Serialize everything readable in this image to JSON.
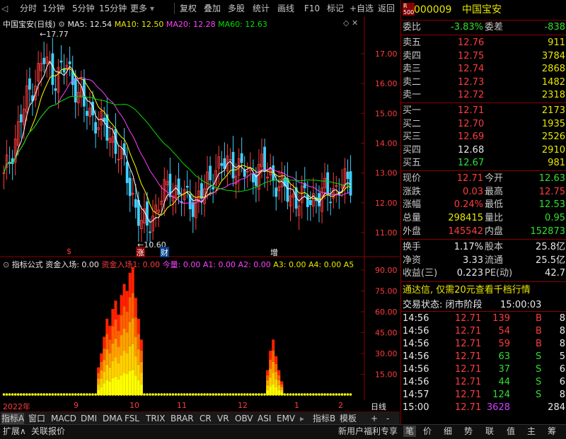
{
  "toolbar": {
    "left": [
      "分时",
      "1分钟",
      "5分钟",
      "15分钟",
      "更多"
    ],
    "right": [
      "复权",
      "叠加",
      "多股",
      "统计",
      "画线",
      "F10",
      "标记",
      "+自选",
      "返回"
    ]
  },
  "kline": {
    "title": "中国宝安(日线)",
    "ma5": "MA5: 12.54",
    "ma10": "MA10: 12.50",
    "ma20": "MA20: 12.28",
    "ma60": "MA60: 12.63",
    "high_label": "17.77",
    "low_label": "10.60",
    "price_ticks": [
      "17.00",
      "16.00",
      "15.00",
      "14.00",
      "13.00",
      "12.00",
      "11.00"
    ],
    "markers": [
      "$",
      "涨",
      "财",
      "增"
    ],
    "colors": {
      "up": "#ff3c3c",
      "down": "#3fd0ff",
      "ma5": "#ffffff",
      "ma10": "#ffff00",
      "ma20": "#ff40ff",
      "ma60": "#00e000"
    }
  },
  "indicator": {
    "title": "指标公式",
    "fund_in": "资金入场: 0.00",
    "fund_in1": "资金入场1: 0.00",
    "jinliang": "今量: 0.00",
    "a1": "A1: 0.00",
    "a2": "A2: 0.00",
    "a3": "A3: 0.00",
    "a4": "A4: 0.00",
    "a5": "A5",
    "ticks": [
      "90.00",
      "75.00",
      "60.00",
      "45.00",
      "30.00",
      "15.00"
    ]
  },
  "time_axis": {
    "labels": [
      "2022年",
      "9",
      "10",
      "11",
      "12",
      "1",
      "2"
    ],
    "period": "日线"
  },
  "tabs_row1": [
    "指标A",
    "窗口",
    "MACD",
    "DMI",
    "DMA",
    "FSL",
    "TRIX",
    "BRAR",
    "CR",
    "VR",
    "OBV",
    "ASI",
    "EMV",
    "指标B",
    "模板",
    "+",
    "-"
  ],
  "tabs_row2_left": [
    "扩展∧",
    "关联报价"
  ],
  "tabs_row2_right": [
    "新用户福利专享",
    "笔",
    "价",
    "细",
    "势",
    "联",
    "值",
    "主",
    "筹"
  ],
  "quote": {
    "code": "000009",
    "name": "中国宝安",
    "weibi_label": "委比",
    "weibi": "-3.83%",
    "weicha_label": "委差",
    "weicha": "-838",
    "asks": [
      {
        "label": "卖五",
        "price": "12.76",
        "vol": "911"
      },
      {
        "label": "卖四",
        "price": "12.75",
        "vol": "3784"
      },
      {
        "label": "卖三",
        "price": "12.74",
        "vol": "2868"
      },
      {
        "label": "卖二",
        "price": "12.73",
        "vol": "1482"
      },
      {
        "label": "卖一",
        "price": "12.72",
        "vol": "2318"
      }
    ],
    "bids": [
      {
        "label": "买一",
        "price": "12.71",
        "vol": "2173"
      },
      {
        "label": "买二",
        "price": "12.70",
        "vol": "1935"
      },
      {
        "label": "买三",
        "price": "12.69",
        "vol": "2526"
      },
      {
        "label": "买四",
        "price": "12.68",
        "vol": "2910"
      },
      {
        "label": "买五",
        "price": "12.67",
        "vol": "981"
      }
    ],
    "stats": [
      {
        "l1": "现价",
        "v1": "12.71",
        "l2": "今开",
        "v2": "12.63"
      },
      {
        "l1": "涨跌",
        "v1": "0.03",
        "l2": "最高",
        "v2": "12.75"
      },
      {
        "l1": "涨幅",
        "v1": "0.24%",
        "l2": "最低",
        "v2": "12.53"
      },
      {
        "l1": "总量",
        "v1": "298415",
        "l2": "量比",
        "v2": "0.95"
      },
      {
        "l1": "外盘",
        "v1": "145542",
        "l2": "内盘",
        "v2": "152873"
      }
    ],
    "stats2": [
      {
        "l1": "换手",
        "v1": "1.17%",
        "l2": "股本",
        "v2": "25.8亿"
      },
      {
        "l1": "净资",
        "v1": "3.33",
        "l2": "流通",
        "v2": "25.5亿"
      },
      {
        "l1": "收益(三)",
        "v1": "0.223",
        "l2": "PE(动)",
        "v2": "42.7"
      }
    ],
    "ad": "通达信, 仅需20元查看千档行情",
    "trade_status": "交易状态: 闭市阶段",
    "trade_time": "15:00:03",
    "ticks": [
      {
        "t": "14:56",
        "p": "12.71",
        "v": "139",
        "f": "B",
        "n": "8"
      },
      {
        "t": "14:56",
        "p": "12.71",
        "v": "54",
        "f": "B",
        "n": "8"
      },
      {
        "t": "14:56",
        "p": "12.71",
        "v": "59",
        "f": "B",
        "n": "8"
      },
      {
        "t": "14:56",
        "p": "12.71",
        "v": "63",
        "f": "S",
        "n": "5"
      },
      {
        "t": "14:56",
        "p": "12.71",
        "v": "37",
        "f": "S",
        "n": "6"
      },
      {
        "t": "14:56",
        "p": "12.71",
        "v": "44",
        "f": "S",
        "n": "6"
      },
      {
        "t": "14:57",
        "p": "12.71",
        "v": "124",
        "f": "S",
        "n": "8"
      },
      {
        "t": "15:00",
        "p": "12.71",
        "v": "3628",
        "f": "",
        "n": "284"
      }
    ]
  }
}
